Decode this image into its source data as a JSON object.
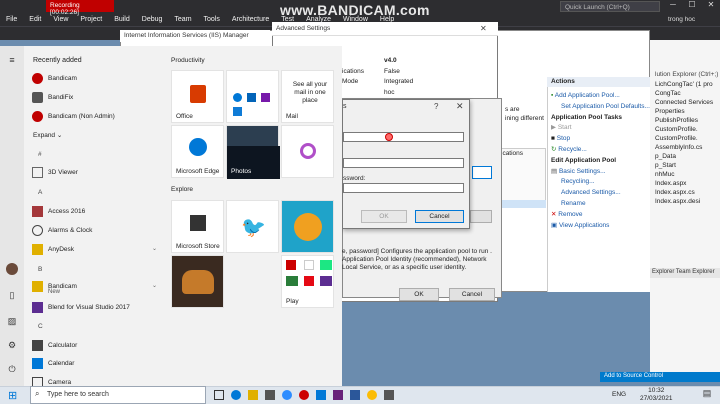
{
  "vs": {
    "menu": [
      "File",
      "Edit",
      "View",
      "Project",
      "Build",
      "Debug",
      "Team",
      "Tools",
      "Architecture",
      "Test",
      "Analyze",
      "Window",
      "Help"
    ],
    "recording": "Recording [00:02:26]",
    "watermark": "www.BANDICAM.com",
    "quick_launch": "Quick Launch (Ctrl+Q)",
    "user": "trong hoc",
    "solution_items": [
      "LichCongTac' (1 pro",
      "CongTac",
      "Connected Services",
      "Properties",
      "PublishProfiles",
      "CustomProfile.",
      "CustomProfile.",
      "AssemblyInfo.cs",
      "",
      "p_Data",
      "p_Start",
      "",
      "nhMuc",
      "Index.aspx",
      "Index.aspx.cs",
      "Index.aspx.desi"
    ],
    "solution_header": "lution Explorer (Ctrl+;)",
    "team_tabs": "Explorer  Team Explorer",
    "status": "Add to Source Control"
  },
  "iis": {
    "title": "Internet Information Services (IIS) Manager",
    "actions_title": "Actions",
    "actions": [
      {
        "label": "Add Application Pool...",
        "kind": "link"
      },
      {
        "label": "Set Application Pool Defaults...",
        "kind": "link"
      },
      {
        "label": "Application Pool Tasks",
        "kind": "head"
      },
      {
        "label": "Start",
        "kind": "disabled"
      },
      {
        "label": "Stop",
        "kind": "link"
      },
      {
        "label": "Recycle...",
        "kind": "link"
      },
      {
        "label": "Edit Application Pool",
        "kind": "head"
      },
      {
        "label": "Basic Settings...",
        "kind": "link"
      },
      {
        "label": "Recycling...",
        "kind": "link"
      },
      {
        "label": "Advanced Settings...",
        "kind": "link"
      },
      {
        "label": "Rename",
        "kind": "link"
      },
      {
        "label": "Remove",
        "kind": "link"
      },
      {
        "label": "View Applications",
        "kind": "link"
      }
    ],
    "partial_text": [
      "s are",
      "ining different"
    ],
    "partial_list": "ications"
  },
  "advanced": {
    "title": "Advanced Settings",
    "rows": [
      {
        "label": "",
        "value": "v4.0"
      },
      {
        "label": "ications",
        "value": "False"
      },
      {
        "label": "Mode",
        "value": "Integrated"
      },
      {
        "label": "",
        "value": "hoc"
      }
    ],
    "description": "e, password] Configures the application pool to run . Application Pool Identity (recommended), Network Local Service, or as a specific user identity.",
    "ok": "OK",
    "cancel": "Cancel"
  },
  "credentials": {
    "title_help": "?",
    "title_close": "✕",
    "title_partial": "s",
    "password_label": "ssword:",
    "ok": "OK",
    "cancel": "Cancel"
  },
  "start": {
    "recently_added": "Recently added",
    "recent_apps": [
      "Bandicam",
      "BandiFix",
      "Bandicam (Non Admin)"
    ],
    "expand": "Expand",
    "sections": [
      "#",
      "A",
      "B",
      "C"
    ],
    "apps": [
      "3D Viewer",
      "Access 2016",
      "Alarms & Clock",
      "AnyDesk",
      "Bandicam",
      "New",
      "Blend for Visual Studio 2017",
      "Calculator",
      "Calendar",
      "Camera"
    ],
    "productivity": "Productivity",
    "explore": "Explore",
    "tiles": {
      "office": "Office",
      "mail_text": "See all your mail in one place",
      "mail": "Mail",
      "edge": "Microsoft Edge",
      "photos": "Photos",
      "store": "Microsoft Store",
      "play": "Play"
    }
  },
  "taskbar": {
    "search_placeholder": "Type here to search",
    "lang": "ENG",
    "time": "10:32",
    "date": "27/03/2021"
  },
  "colors": {
    "vs_dark": "#2d2d30",
    "rec_red": "#c00000",
    "link_blue": "#1a5aa8",
    "office_red": "#d83b01",
    "edge_blue": "#0078d7"
  }
}
